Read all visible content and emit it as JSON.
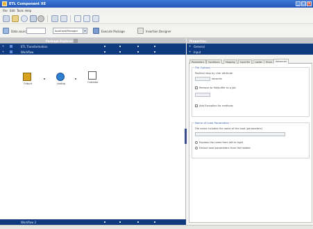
{
  "window": {
    "title": "ETL Component XE",
    "min_glyph": "_",
    "max_glyph": "□",
    "close_glyph": "x"
  },
  "menu": [
    {
      "label": "File"
    },
    {
      "label": "Edit"
    },
    {
      "label": "Tools"
    },
    {
      "label": "Help"
    }
  ],
  "toolbar": {
    "icons": [
      "new-icon",
      "open-icon",
      "back-icon",
      "save-icon",
      "cut-icon",
      "copy-icon",
      "paste-icon",
      "grid-icon",
      "chart-icon",
      "help-icon"
    ]
  },
  "combo_row": {
    "data_label": "Data source",
    "data_value": "",
    "server_value": "localhost/Manager",
    "action_label": "Execute Package",
    "insert_label": "Insertion Designer"
  },
  "left_pane": {
    "header": "Package Explorer",
    "groups": [
      {
        "label": "ETL Transformation",
        "expander": "+"
      },
      {
        "label": "Workflow",
        "expander": "+"
      }
    ],
    "nodes": [
      {
        "label": "Output",
        "icon": "export-icon",
        "color": "#d7a21e"
      },
      {
        "label": "Lookup",
        "icon": "sphere-icon",
        "color": "#2f7fd1"
      },
      {
        "label": "Calendar",
        "icon": "calendar-icon",
        "color": "#7a7a7a"
      }
    ],
    "bottom_group": "Workflow 2"
  },
  "properties": {
    "title": "Properties",
    "sections": [
      {
        "label": "General",
        "expander": "+"
      },
      {
        "label": "Input",
        "expander": "+"
      }
    ],
    "tabs": [
      {
        "label": "Parameters"
      },
      {
        "label": "Conditions"
      },
      {
        "label": "Mapping"
      },
      {
        "label": "Input file"
      },
      {
        "label": "Loader"
      },
      {
        "label": "Errors"
      },
      {
        "label": "Advanced"
      }
    ],
    "active_tab": "Advanced",
    "fieldset1": {
      "legend": "File Options",
      "text1": "Position stop by char attribute",
      "input1_value": "",
      "input1_suffix": "seconds",
      "check1_label": "Remove to file/buffer to a job",
      "input2_value": "",
      "check2_label": "Add Exception for methods"
    },
    "fieldset2": {
      "legend": "Name of Load Parameters",
      "text1": "File name includes the name of the load (parameters)",
      "input_value": "",
      "radio1_label": "Express the name from left to right",
      "radio2_label": "Extract load parameters from the header"
    }
  },
  "colors": {
    "title_bar": "#2456b8",
    "group_bar": "#103a7e",
    "accent_link": "#2d5aa8"
  }
}
